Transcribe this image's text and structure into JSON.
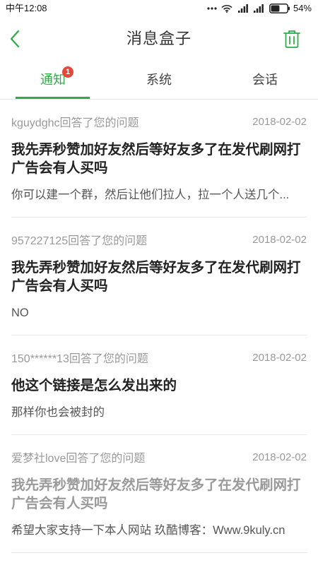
{
  "status_bar": {
    "time": "中午12:08",
    "battery_label": "54%",
    "battery_level": 54,
    "icons": [
      "more-dots-icon",
      "wifi-icon",
      "signal-icon",
      "signal-icon",
      "battery-icon"
    ]
  },
  "header": {
    "title": "消息盒子",
    "back_icon": "chevron-left-icon",
    "action_icon": "trash-icon"
  },
  "tabs": [
    {
      "label": "通知",
      "active": true,
      "badge": "1"
    },
    {
      "label": "系统",
      "active": false
    },
    {
      "label": "会话",
      "active": false
    }
  ],
  "colors": {
    "accent": "#2fac48",
    "badge": "#e5483a",
    "title": "#222222",
    "meta": "#999999",
    "excerpt": "#555555"
  },
  "messages": [
    {
      "sender_line": "kguydghc回答了您的问题",
      "date": "2018-02-02",
      "title": "我先弄秒赞加好友然后等好友多了在发代刷网打广告会有人买吗",
      "excerpt": "你可以建一个群，然后让他们拉人，拉一个人送几个...",
      "title_color": "#222222"
    },
    {
      "sender_line": "957227125回答了您的问题",
      "date": "2018-02-02",
      "title": "我先弄秒赞加好友然后等好友多了在发代刷网打广告会有人买吗",
      "excerpt": "NO",
      "title_color": "#222222"
    },
    {
      "sender_line": "150******13回答了您的问题",
      "date": "2018-02-02",
      "title": "他这个链接是怎么发出来的",
      "excerpt": "那样你也会被封的",
      "title_color": "#222222"
    },
    {
      "sender_line": "爱梦社love回答了您的问题",
      "date": "2018-02-02",
      "title": "我先弄秒赞加好友然后等好友多了在发代刷网打广告会有人买吗",
      "excerpt": "希望大家支持一下本人网站 玖酷博客：Www.9kuly.cn",
      "title_color": "#9a9a9a"
    }
  ]
}
